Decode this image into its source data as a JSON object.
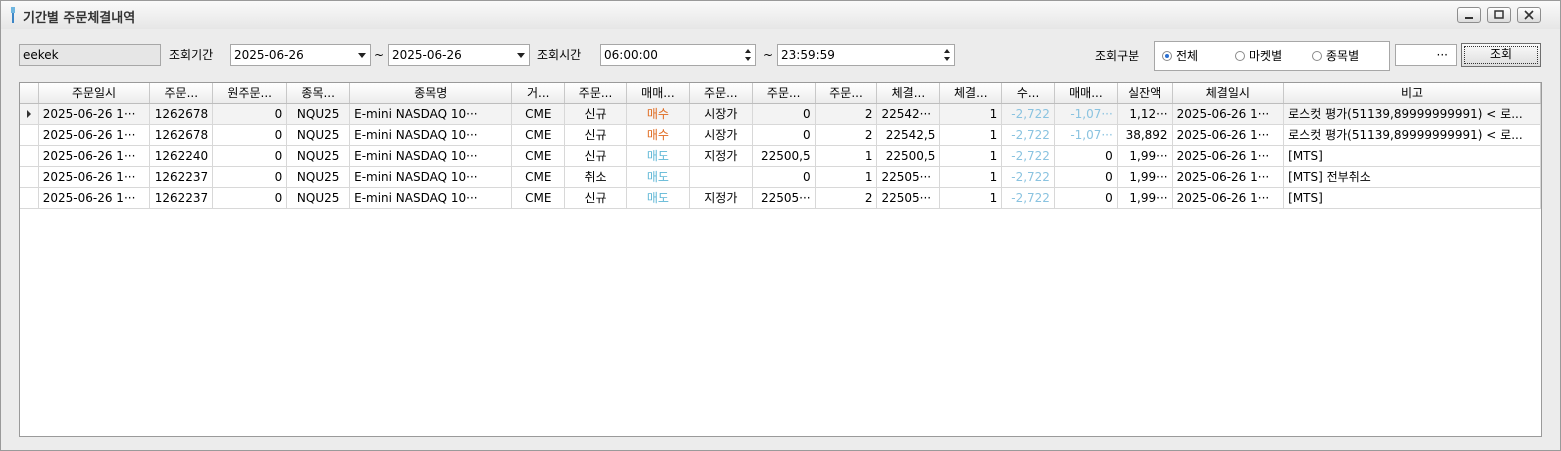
{
  "window": {
    "title": "기간별 주문체결내역",
    "buttons": [
      "minimize",
      "maximize",
      "close"
    ]
  },
  "filter": {
    "account_value": "eekek",
    "period_label": "조회기간",
    "date_from": "2025-06-26",
    "tilde": "~",
    "date_to": "2025-06-26",
    "time_label": "조회시간",
    "time_from": "06:00:00",
    "time_to": "23:59:59",
    "category_label": "조회구분",
    "radio_all": "전체",
    "radio_market": "마켓별",
    "radio_symbol": "종목별",
    "selected_radio": "전체",
    "ellipsis_label": "···",
    "search_button": "조회"
  },
  "table": {
    "headers": [
      "",
      "주문일시",
      "주문...",
      "원주문...",
      "종목...",
      "종목명",
      "거...",
      "주문...",
      "매매...",
      "주문...",
      "주문...",
      "주문...",
      "체결...",
      "체결...",
      "수...",
      "매매...",
      "실잔액",
      "체결일시",
      "비고"
    ],
    "rows": [
      {
        "selected": true,
        "cells": [
          "2025-06-26 1···",
          "1262678",
          "0",
          "NQU25",
          "E-mini NASDAQ 10···",
          "CME",
          "신규",
          "매수",
          "시장가",
          "0",
          "2",
          "22542···",
          "1",
          "-2,722",
          "-1,07···",
          "1,12···",
          "2025-06-26 1···",
          "로스컷 평가(51139,89999999991) < 로..."
        ]
      },
      {
        "selected": false,
        "cells": [
          "2025-06-26 1···",
          "1262678",
          "0",
          "NQU25",
          "E-mini NASDAQ 10···",
          "CME",
          "신규",
          "매수",
          "시장가",
          "0",
          "2",
          "22542,5",
          "1",
          "-2,722",
          "-1,07···",
          "38,892",
          "2025-06-26 1···",
          "로스컷 평가(51139,89999999991) < 로..."
        ]
      },
      {
        "selected": false,
        "cells": [
          "2025-06-26 1···",
          "1262240",
          "0",
          "NQU25",
          "E-mini NASDAQ 10···",
          "CME",
          "신규",
          "매도",
          "지정가",
          "22500,5",
          "1",
          "22500,5",
          "1",
          "-2,722",
          "0",
          "1,99···",
          "2025-06-26 1···",
          "[MTS]"
        ]
      },
      {
        "selected": false,
        "cells": [
          "2025-06-26 1···",
          "1262237",
          "0",
          "NQU25",
          "E-mini NASDAQ 10···",
          "CME",
          "취소",
          "매도",
          "",
          "0",
          "1",
          "22505···",
          "1",
          "-2,722",
          "0",
          "1,99···",
          "2025-06-26 1···",
          "[MTS] 전부취소"
        ]
      },
      {
        "selected": false,
        "cells": [
          "2025-06-26 1···",
          "1262237",
          "0",
          "NQU25",
          "E-mini NASDAQ 10···",
          "CME",
          "신규",
          "매도",
          "지정가",
          "22505···",
          "2",
          "22505···",
          "1",
          "-2,722",
          "0",
          "1,99···",
          "2025-06-26 1···",
          "[MTS]"
        ]
      }
    ]
  },
  "colors": {
    "buy": "#e06a1e",
    "sell": "#5fb7d6",
    "negative_blue": "#8ac3e0"
  }
}
